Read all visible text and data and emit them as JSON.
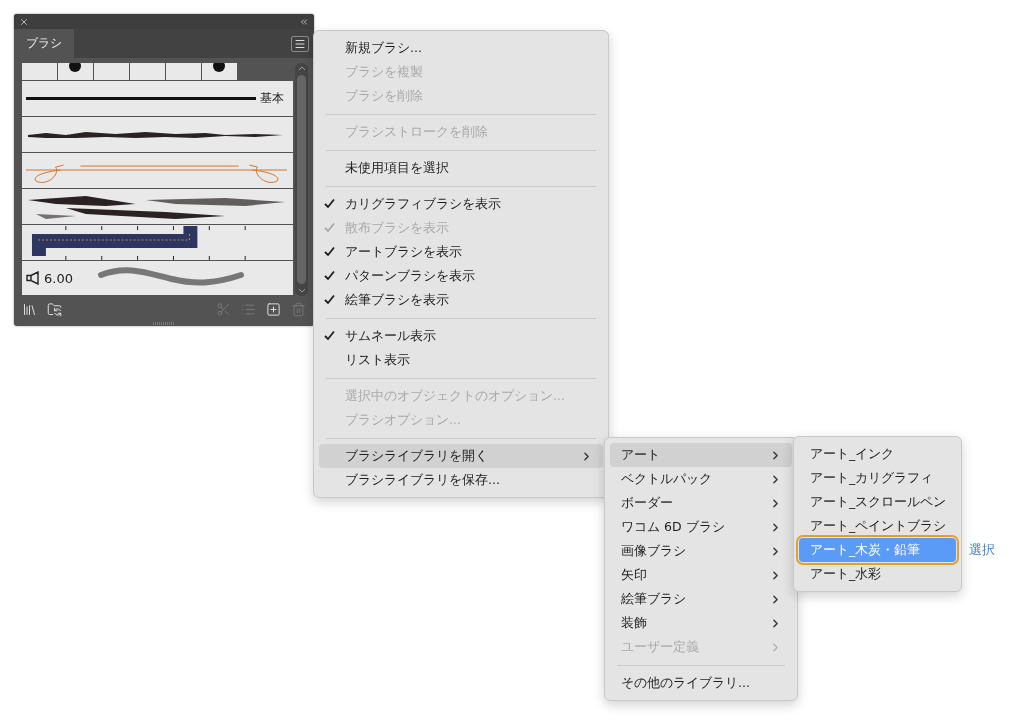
{
  "panel": {
    "tab": {
      "label": "ブラシ",
      "selected": true
    },
    "brushes": [
      {
        "kind": "swatches"
      },
      {
        "kind": "basic",
        "label": "基本"
      },
      {
        "kind": "charcoal"
      },
      {
        "kind": "scroll"
      },
      {
        "kind": "charcoal-wide"
      },
      {
        "kind": "pattern"
      },
      {
        "kind": "bristle",
        "size": "6.00"
      }
    ],
    "tools": [
      {
        "kind": "library",
        "disabled": false
      },
      {
        "kind": "cloud-library",
        "disabled": false
      },
      {
        "kind": "remove-stroke",
        "disabled": true
      },
      {
        "kind": "options",
        "disabled": true
      },
      {
        "kind": "new",
        "disabled": false
      },
      {
        "kind": "delete",
        "disabled": true
      }
    ]
  },
  "menu": {
    "items": [
      {
        "kind": "item",
        "label": "新規ブラシ...",
        "disabled": false,
        "checked": false,
        "submenu": false,
        "selected": false
      },
      {
        "kind": "item",
        "label": "ブラシを複製",
        "disabled": true,
        "checked": false,
        "submenu": false,
        "selected": false
      },
      {
        "kind": "item",
        "label": "ブラシを削除",
        "disabled": true,
        "checked": false,
        "submenu": false,
        "selected": false
      },
      {
        "kind": "separator"
      },
      {
        "kind": "item",
        "label": "ブラシストロークを削除",
        "disabled": true,
        "checked": false,
        "submenu": false,
        "selected": false
      },
      {
        "kind": "separator"
      },
      {
        "kind": "item",
        "label": "未使用項目を選択",
        "disabled": false,
        "checked": false,
        "submenu": false,
        "selected": false
      },
      {
        "kind": "separator"
      },
      {
        "kind": "item",
        "label": "カリグラフィブラシを表示",
        "disabled": false,
        "checked": true,
        "submenu": false,
        "selected": false
      },
      {
        "kind": "item",
        "label": "散布ブラシを表示",
        "disabled": true,
        "checked": true,
        "submenu": false,
        "selected": false
      },
      {
        "kind": "item",
        "label": "アートブラシを表示",
        "disabled": false,
        "checked": true,
        "submenu": false,
        "selected": false
      },
      {
        "kind": "item",
        "label": "パターンブラシを表示",
        "disabled": false,
        "checked": true,
        "submenu": false,
        "selected": false
      },
      {
        "kind": "item",
        "label": "絵筆ブラシを表示",
        "disabled": false,
        "checked": true,
        "submenu": false,
        "selected": false
      },
      {
        "kind": "separator"
      },
      {
        "kind": "item",
        "label": "サムネール表示",
        "disabled": false,
        "checked": true,
        "submenu": false,
        "selected": false
      },
      {
        "kind": "item",
        "label": "リスト表示",
        "disabled": false,
        "checked": false,
        "submenu": false,
        "selected": false
      },
      {
        "kind": "separator"
      },
      {
        "kind": "item",
        "label": "選択中のオブジェクトのオプション...",
        "disabled": true,
        "checked": false,
        "submenu": false,
        "selected": false
      },
      {
        "kind": "item",
        "label": "ブラシオプション...",
        "disabled": true,
        "checked": false,
        "submenu": false,
        "selected": false
      },
      {
        "kind": "separator"
      },
      {
        "kind": "item",
        "label": "ブラシライブラリを開く",
        "disabled": false,
        "checked": false,
        "submenu": true,
        "selected": true
      },
      {
        "kind": "item",
        "label": "ブラシライブラリを保存...",
        "disabled": false,
        "checked": false,
        "submenu": false,
        "selected": false
      }
    ]
  },
  "library_menu": {
    "items": [
      {
        "kind": "item",
        "label": "アート",
        "disabled": false,
        "submenu": true,
        "selected": true
      },
      {
        "kind": "item",
        "label": "ベクトルパック",
        "disabled": false,
        "submenu": true,
        "selected": false
      },
      {
        "kind": "item",
        "label": "ボーダー",
        "disabled": false,
        "submenu": true,
        "selected": false
      },
      {
        "kind": "item",
        "label": "ワコム 6D ブラシ",
        "disabled": false,
        "submenu": true,
        "selected": false
      },
      {
        "kind": "item",
        "label": "画像ブラシ",
        "disabled": false,
        "submenu": true,
        "selected": false
      },
      {
        "kind": "item",
        "label": "矢印",
        "disabled": false,
        "submenu": true,
        "selected": false
      },
      {
        "kind": "item",
        "label": "絵筆ブラシ",
        "disabled": false,
        "submenu": true,
        "selected": false
      },
      {
        "kind": "item",
        "label": "装飾",
        "disabled": false,
        "submenu": true,
        "selected": false
      },
      {
        "kind": "item",
        "label": "ユーザー定義",
        "disabled": true,
        "submenu": true,
        "selected": false
      },
      {
        "kind": "separator"
      },
      {
        "kind": "item",
        "label": "その他のライブラリ...",
        "disabled": false,
        "submenu": false,
        "selected": false
      }
    ]
  },
  "art_menu": {
    "items": [
      {
        "kind": "item",
        "label": "アート_インク",
        "selected": false
      },
      {
        "kind": "item",
        "label": "アート_カリグラフィ",
        "selected": false
      },
      {
        "kind": "item",
        "label": "アート_スクロールペン",
        "selected": false
      },
      {
        "kind": "item",
        "label": "アート_ペイントブラシ",
        "selected": false
      },
      {
        "kind": "item",
        "label": "アート_木炭・鉛筆",
        "selected": true
      },
      {
        "kind": "item",
        "label": "アート_水彩",
        "selected": false
      }
    ]
  },
  "annotation": {
    "label": "選択"
  }
}
